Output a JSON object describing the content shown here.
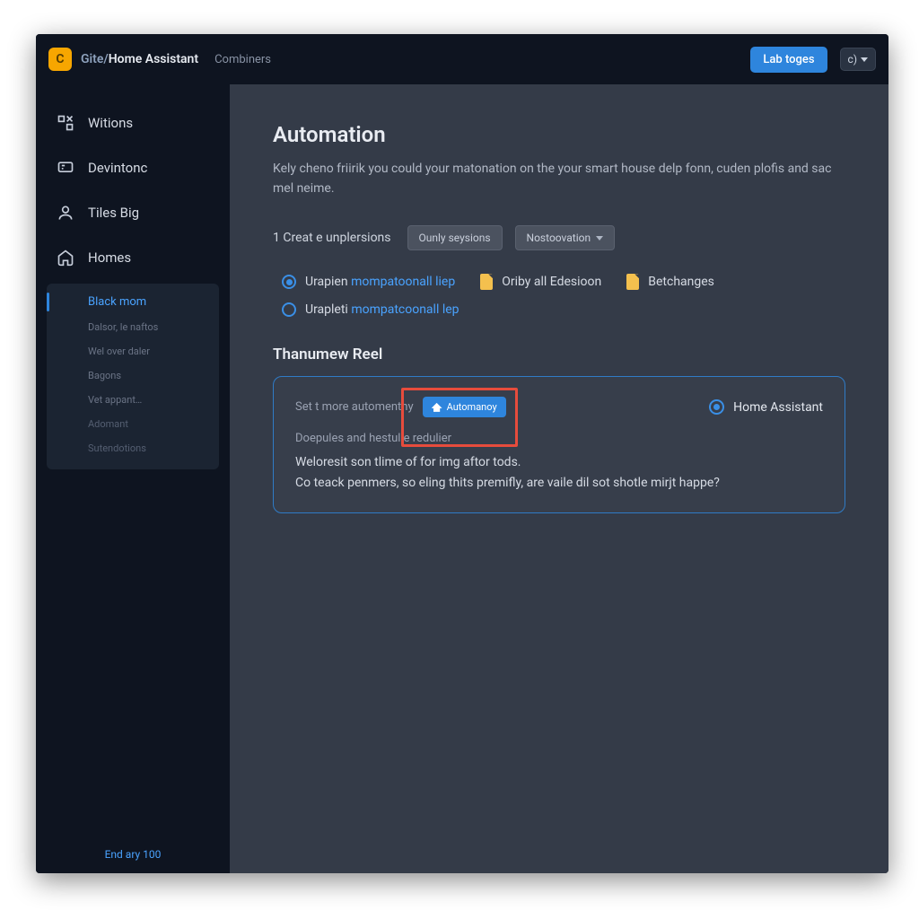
{
  "header": {
    "logo_letter": "C",
    "app_title": "Home Assistant",
    "app_prefix": "Gite/",
    "sub": "Combiners",
    "primary_btn": "Lab toges",
    "icon_btn": "c)"
  },
  "sidebar": {
    "items": [
      {
        "label": "Witions"
      },
      {
        "label": "Devintonc"
      },
      {
        "label": "Tiles Big"
      },
      {
        "label": "Homes"
      }
    ],
    "sub": {
      "current": "Black mom",
      "dim": [
        "Dalsor, le naftos",
        "Wel over daler",
        "Bagons",
        "Vet appant…",
        "Adomant",
        "Sutendotions"
      ]
    },
    "footer": "End ary 100"
  },
  "main": {
    "title": "Automation",
    "subtitle": "Kely cheno friirik you could your matonation on the your smart house delp fonn, cuden plofis and sac mel neime.",
    "controls": {
      "label": "1 Creat e unplersions",
      "pill1": "Ounly seysions",
      "pill2": "Nostoovation"
    },
    "options": {
      "row1_a_pre": "Urapien ",
      "row1_a_link": "mompatoonall liep",
      "row1_b": "Oriby all Edesioon",
      "row1_c": "Betchanges",
      "row2_pre": "Urapleti ",
      "row2_link": "mompatcoonall lep"
    },
    "section2": "Thanumew Reel",
    "card": {
      "top_label": "Set t more automenthy",
      "chip": "Automanoy",
      "right": "Home Assistant",
      "sub": "Doepules and hestulie redulier",
      "line1": "Weloresit son tlime of for img aftor tods.",
      "line2": "Co teack penmers, so eling thits premifly, are vaile dil sot shotle mirjt happe?"
    }
  }
}
